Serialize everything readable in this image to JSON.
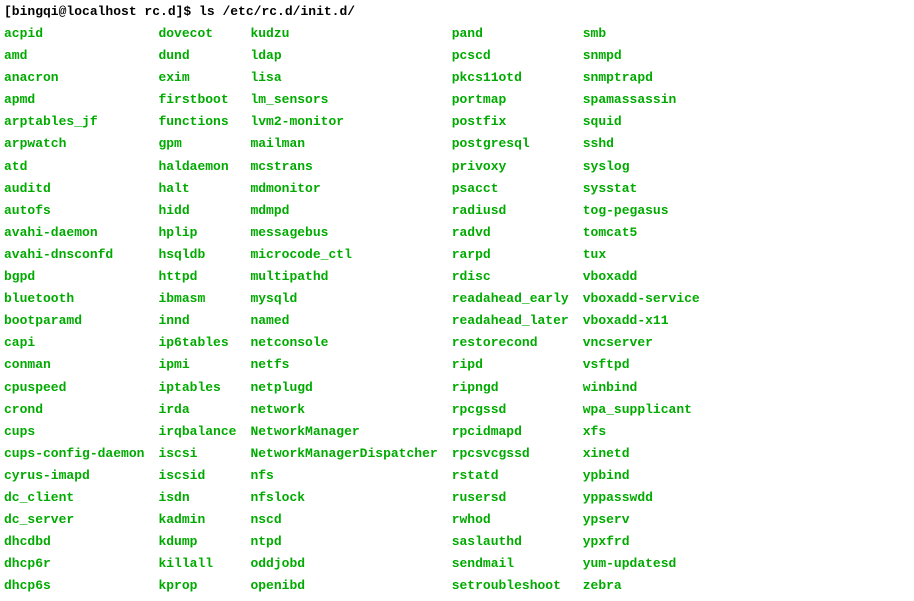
{
  "prompt": {
    "user_host": "[bingqi@localhost rc.d]$",
    "command": "ls /etc/rc.d/init.d/"
  },
  "columns": [
    [
      "acpid",
      "amd",
      "anacron",
      "apmd",
      "arptables_jf",
      "arpwatch",
      "atd",
      "auditd",
      "autofs",
      "avahi-daemon",
      "avahi-dnsconfd",
      "bgpd",
      "bluetooth",
      "bootparamd",
      "capi",
      "conman",
      "cpuspeed",
      "crond",
      "cups",
      "cups-config-daemon",
      "cyrus-imapd",
      "dc_client",
      "dc_server",
      "dhcdbd",
      "dhcp6r",
      "dhcp6s"
    ],
    [
      "dovecot",
      "dund",
      "exim",
      "firstboot",
      "functions",
      "gpm",
      "haldaemon",
      "halt",
      "hidd",
      "hplip",
      "hsqldb",
      "httpd",
      "ibmasm",
      "innd",
      "ip6tables",
      "ipmi",
      "iptables",
      "irda",
      "irqbalance",
      "iscsi",
      "iscsid",
      "isdn",
      "kadmin",
      "kdump",
      "killall",
      "kprop"
    ],
    [
      "kudzu",
      "ldap",
      "lisa",
      "lm_sensors",
      "lvm2-monitor",
      "mailman",
      "mcstrans",
      "mdmonitor",
      "mdmpd",
      "messagebus",
      "microcode_ctl",
      "multipathd",
      "mysqld",
      "named",
      "netconsole",
      "netfs",
      "netplugd",
      "network",
      "NetworkManager",
      "NetworkManagerDispatcher",
      "nfs",
      "nfslock",
      "nscd",
      "ntpd",
      "oddjobd",
      "openibd"
    ],
    [
      "pand",
      "pcscd",
      "pkcs11otd",
      "portmap",
      "postfix",
      "postgresql",
      "privoxy",
      "psacct",
      "radiusd",
      "radvd",
      "rarpd",
      "rdisc",
      "readahead_early",
      "readahead_later",
      "restorecond",
      "ripd",
      "ripngd",
      "rpcgssd",
      "rpcidmapd",
      "rpcsvcgssd",
      "rstatd",
      "rusersd",
      "rwhod",
      "saslauthd",
      "sendmail",
      "setroubleshoot"
    ],
    [
      "smb",
      "snmpd",
      "snmptrapd",
      "spamassassin",
      "squid",
      "sshd",
      "syslog",
      "sysstat",
      "tog-pegasus",
      "tomcat5",
      "tux",
      "vboxadd",
      "vboxadd-service",
      "vboxadd-x11",
      "vncserver",
      "vsftpd",
      "winbind",
      "wpa_supplicant",
      "xfs",
      "xinetd",
      "ypbind",
      "yppasswdd",
      "ypserv",
      "ypxfrd",
      "yum-updatesd",
      "zebra"
    ]
  ]
}
